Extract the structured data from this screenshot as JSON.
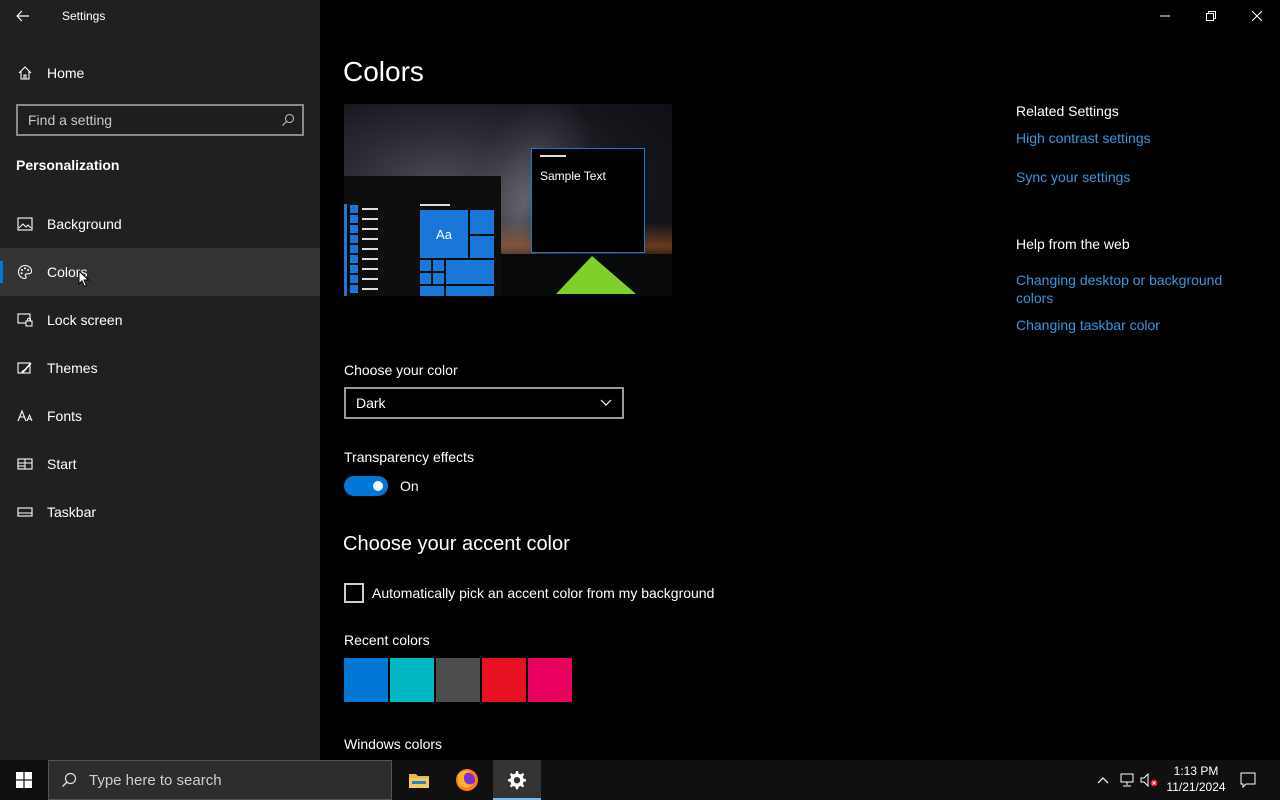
{
  "window": {
    "title": "Settings"
  },
  "sidebar": {
    "home_label": "Home",
    "search_placeholder": "Find a setting",
    "section_title": "Personalization",
    "items": [
      {
        "label": "Background",
        "icon": "picture-icon"
      },
      {
        "label": "Colors",
        "icon": "palette-icon",
        "selected": true
      },
      {
        "label": "Lock screen",
        "icon": "lock-screen-icon"
      },
      {
        "label": "Themes",
        "icon": "brush-icon"
      },
      {
        "label": "Fonts",
        "icon": "font-icon"
      },
      {
        "label": "Start",
        "icon": "start-icon"
      },
      {
        "label": "Taskbar",
        "icon": "taskbar-icon"
      }
    ]
  },
  "main": {
    "title": "Colors",
    "preview": {
      "tile_text": "Aa",
      "sample_text": "Sample Text"
    },
    "choose_color": {
      "label": "Choose your color",
      "selected": "Dark"
    },
    "transparency": {
      "label": "Transparency effects",
      "state": "On"
    },
    "accent_heading": "Choose your accent color",
    "auto_pick_label": "Automatically pick an accent color from my background",
    "recent_colors_label": "Recent colors",
    "recent_colors": [
      "#0078d7",
      "#00b7c3",
      "#4c4c4c",
      "#e81123",
      "#ea005e"
    ],
    "windows_colors_label": "Windows colors"
  },
  "related": {
    "related_heading": "Related Settings",
    "high_contrast": "High contrast settings",
    "sync": "Sync your settings",
    "help_heading": "Help from the web",
    "changing_desktop": "Changing desktop or background colors",
    "changing_taskbar": "Changing taskbar color"
  },
  "taskbar": {
    "search_placeholder": "Type here to search",
    "time": "1:13 PM",
    "date": "11/21/2024"
  },
  "colors": {
    "accent": "#0078d7",
    "link": "#3a96dd",
    "sidebar_bg": "#202020",
    "main_bg": "#000000"
  }
}
